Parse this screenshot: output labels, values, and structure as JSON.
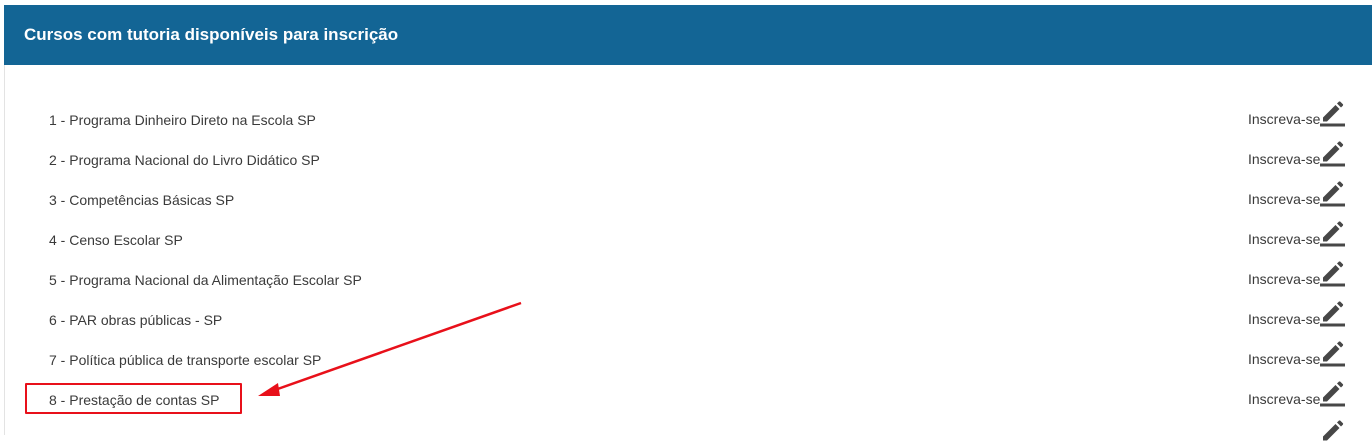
{
  "panel": {
    "title": "Cursos com tutoria disponíveis para inscrição",
    "header_color": "#136595"
  },
  "courses": [
    {
      "name": "1 - Programa Dinheiro Direto na Escola SP",
      "action": "Inscreva-se"
    },
    {
      "name": "2 - Programa Nacional do Livro Didático SP",
      "action": "Inscreva-se"
    },
    {
      "name": "3 - Competências Básicas SP",
      "action": "Inscreva-se"
    },
    {
      "name": "4 - Censo Escolar SP",
      "action": "Inscreva-se"
    },
    {
      "name": "5 - Programa Nacional da Alimentação Escolar SP",
      "action": "Inscreva-se"
    },
    {
      "name": "6 - PAR obras públicas - SP",
      "action": "Inscreva-se"
    },
    {
      "name": "7 - Política pública de transporte escolar SP",
      "action": "Inscreva-se"
    },
    {
      "name": "8 - Prestação de contas SP",
      "action": "Inscreva-se"
    }
  ],
  "icons": {
    "enroll": "pencil-icon"
  },
  "annotation": {
    "highlight_color": "#e8101a",
    "highlighted_course_index": 7
  }
}
